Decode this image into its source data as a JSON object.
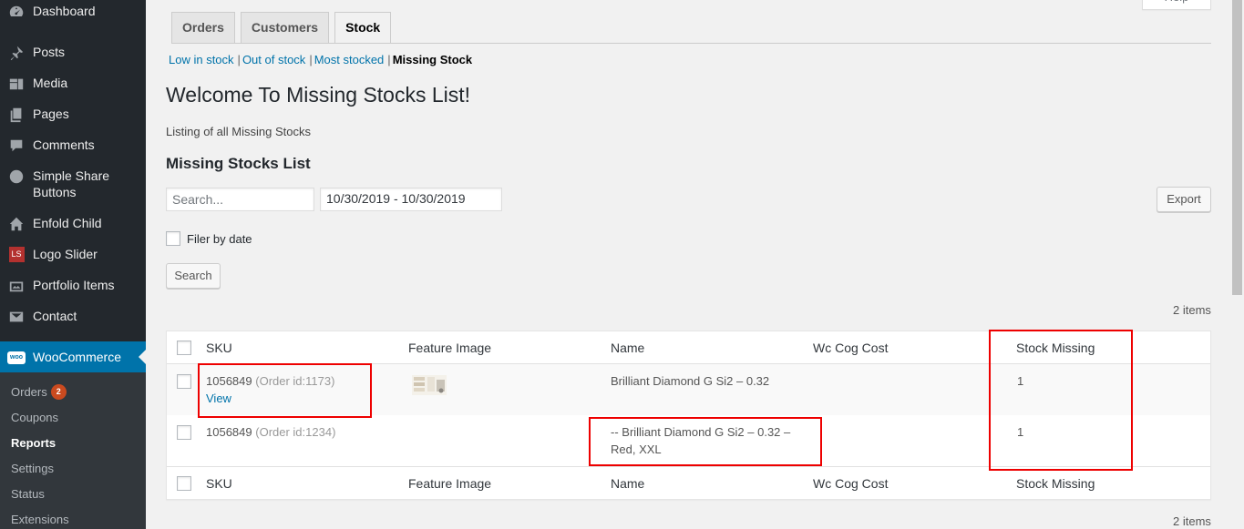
{
  "sidebar": {
    "items": [
      {
        "label": "Dashboard",
        "icon": "dashboard-icon"
      },
      {
        "label": "Posts",
        "icon": "pin-icon"
      },
      {
        "label": "Media",
        "icon": "media-icon"
      },
      {
        "label": "Pages",
        "icon": "pages-icon"
      },
      {
        "label": "Comments",
        "icon": "comment-icon"
      },
      {
        "label": "Simple Share Buttons",
        "icon": "share-icon"
      },
      {
        "label": "Enfold Child",
        "icon": "home-icon"
      },
      {
        "label": "Logo Slider",
        "icon": "ls-icon",
        "icon_text": "LS"
      },
      {
        "label": "Portfolio Items",
        "icon": "portfolio-icon"
      },
      {
        "label": "Contact",
        "icon": "mail-icon"
      }
    ],
    "woocommerce": {
      "label": "WooCommerce",
      "icon": "woo-icon",
      "icon_text": "woo"
    },
    "submenu": [
      {
        "label": "Orders",
        "badge": "2"
      },
      {
        "label": "Coupons"
      },
      {
        "label": "Reports",
        "current": true
      },
      {
        "label": "Settings"
      },
      {
        "label": "Status"
      },
      {
        "label": "Extensions"
      }
    ]
  },
  "help_tab": "Help",
  "tabs": [
    {
      "label": "Orders"
    },
    {
      "label": "Customers"
    },
    {
      "label": "Stock",
      "active": true
    }
  ],
  "subnav": {
    "low_in_stock": "Low in stock",
    "out_of_stock": "Out of stock",
    "most_stocked": "Most stocked",
    "missing_stock": "Missing Stock",
    "separator": "|"
  },
  "page_title": "Welcome To Missing Stocks List!",
  "page_description": "Listing of all Missing Stocks",
  "list_title": "Missing Stocks List",
  "search": {
    "placeholder": "Search...",
    "value": ""
  },
  "date_range": "10/30/2019 - 10/30/2019",
  "export_label": "Export",
  "filter_label": "Filer by date",
  "search_button": "Search",
  "items_count": "2 items",
  "table": {
    "columns": [
      "SKU",
      "Feature Image",
      "Name",
      "Wc Cog Cost",
      "Stock Missing"
    ],
    "rows": [
      {
        "sku": "1056849",
        "order": "(Order id:1173)",
        "view": "View",
        "has_image": true,
        "name": "Brilliant Diamond G Si2 – 0.32",
        "name2": "",
        "cost": "",
        "missing": "1"
      },
      {
        "sku": "1056849",
        "order": "(Order id:1234)",
        "view": "",
        "has_image": false,
        "name": "-- Brilliant Diamond G Si2 – 0.32 –",
        "name2": "Red, XXL",
        "cost": "",
        "missing": "1"
      }
    ]
  },
  "colors": {
    "sidebar_bg": "#23282d",
    "submenu_bg": "#32373c",
    "accent": "#0073aa",
    "badge": "#ca4a1f",
    "highlight": "#e00000"
  }
}
